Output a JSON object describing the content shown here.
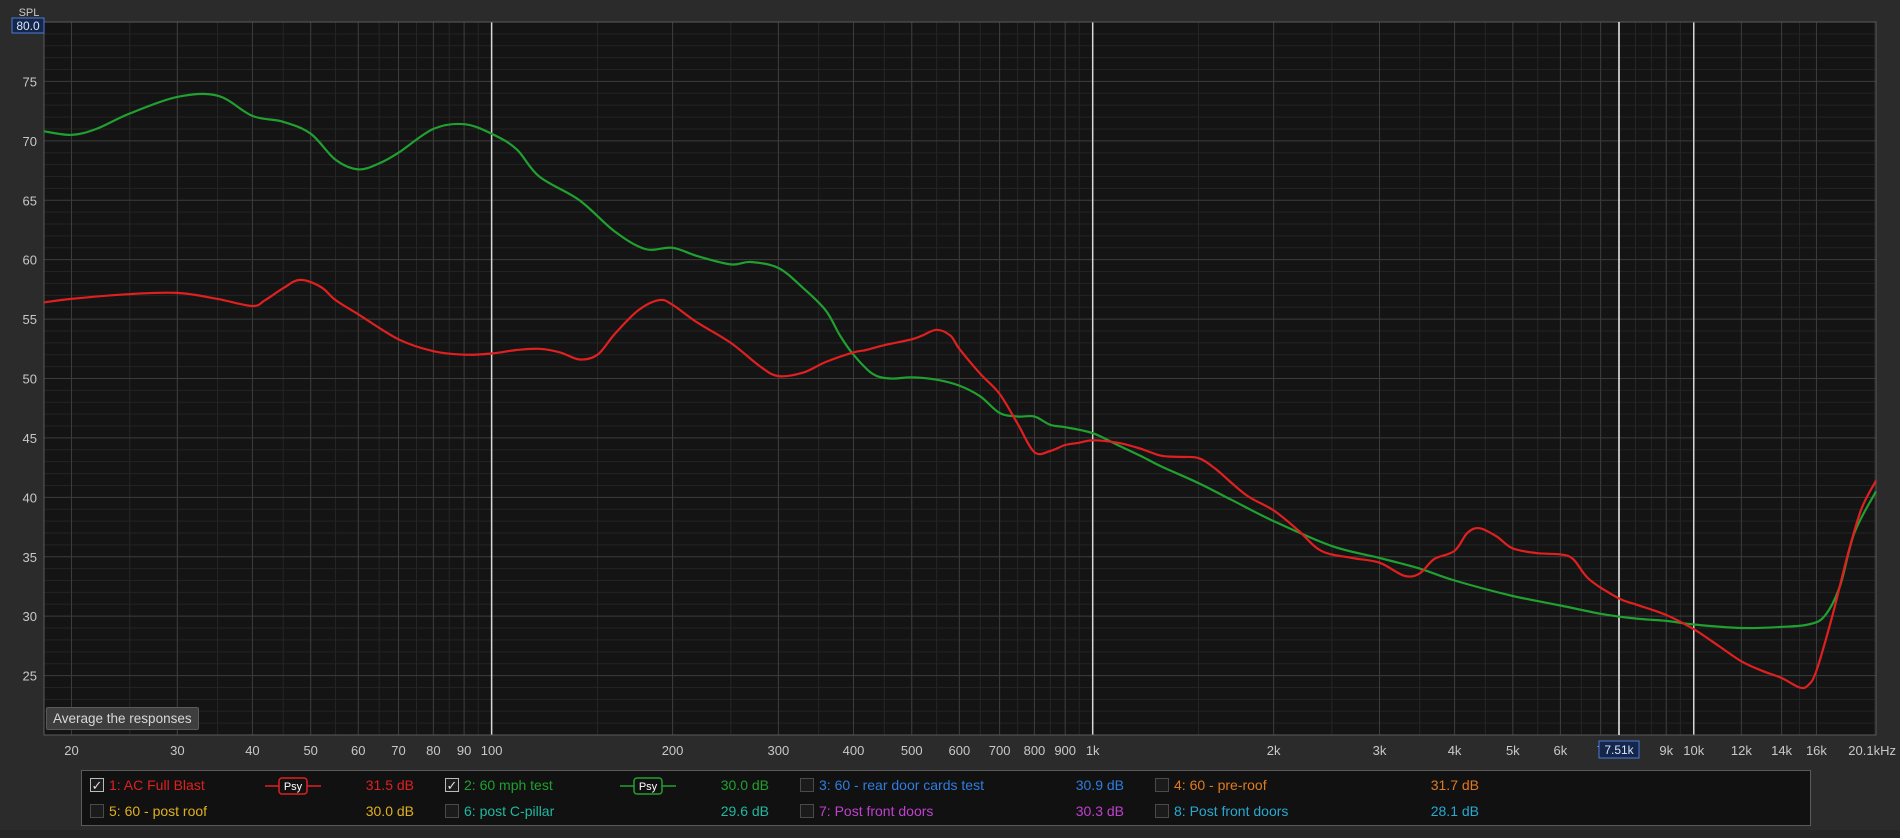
{
  "chart_data": {
    "type": "line",
    "x_scale": "log",
    "xlim": [
      18,
      20100
    ],
    "ylim": [
      20,
      80
    ],
    "ylabel": "SPL",
    "y_top_label": "80.0",
    "y_ticks": [
      25,
      30,
      35,
      40,
      45,
      50,
      55,
      60,
      65,
      70,
      75
    ],
    "x_ticks": [
      {
        "v": 20,
        "label": "20"
      },
      {
        "v": 30,
        "label": "30"
      },
      {
        "v": 40,
        "label": "40"
      },
      {
        "v": 50,
        "label": "50"
      },
      {
        "v": 60,
        "label": "60"
      },
      {
        "v": 70,
        "label": "70"
      },
      {
        "v": 80,
        "label": "80"
      },
      {
        "v": 90,
        "label": "90"
      },
      {
        "v": 100,
        "label": "100"
      },
      {
        "v": 200,
        "label": "200"
      },
      {
        "v": 300,
        "label": "300"
      },
      {
        "v": 400,
        "label": "400"
      },
      {
        "v": 500,
        "label": "500"
      },
      {
        "v": 600,
        "label": "600"
      },
      {
        "v": 700,
        "label": "700"
      },
      {
        "v": 800,
        "label": "800"
      },
      {
        "v": 900,
        "label": "900"
      },
      {
        "v": 1000,
        "label": "1k"
      },
      {
        "v": 2000,
        "label": "2k"
      },
      {
        "v": 3000,
        "label": "3k"
      },
      {
        "v": 4000,
        "label": "4k"
      },
      {
        "v": 5000,
        "label": "5k"
      },
      {
        "v": 6000,
        "label": "6k"
      },
      {
        "v": 7000,
        "label": "7"
      },
      {
        "v": 9000,
        "label": "9k"
      },
      {
        "v": 10000,
        "label": "10k"
      },
      {
        "v": 12000,
        "label": "12k"
      },
      {
        "v": 14000,
        "label": "14k"
      },
      {
        "v": 16000,
        "label": "16k"
      },
      {
        "v": 20100,
        "label": "20.1kHz"
      }
    ],
    "cursor": {
      "freq": 7510,
      "label": "7.51k"
    },
    "grid": true,
    "series": [
      {
        "name": "1: AC Full Blast",
        "color": "#e02020",
        "points": [
          [
            18,
            56.4
          ],
          [
            20,
            56.7
          ],
          [
            25,
            57.1
          ],
          [
            30,
            57.2
          ],
          [
            35,
            56.7
          ],
          [
            40,
            56.1
          ],
          [
            42,
            56.6
          ],
          [
            45,
            57.6
          ],
          [
            48,
            58.3
          ],
          [
            52,
            57.7
          ],
          [
            55,
            56.6
          ],
          [
            60,
            55.4
          ],
          [
            70,
            53.3
          ],
          [
            80,
            52.3
          ],
          [
            90,
            52.0
          ],
          [
            100,
            52.1
          ],
          [
            110,
            52.4
          ],
          [
            120,
            52.5
          ],
          [
            130,
            52.2
          ],
          [
            140,
            51.6
          ],
          [
            150,
            52.0
          ],
          [
            160,
            53.7
          ],
          [
            175,
            55.7
          ],
          [
            190,
            56.6
          ],
          [
            200,
            56.2
          ],
          [
            220,
            54.7
          ],
          [
            250,
            53.0
          ],
          [
            280,
            51.0
          ],
          [
            300,
            50.2
          ],
          [
            330,
            50.5
          ],
          [
            360,
            51.4
          ],
          [
            400,
            52.2
          ],
          [
            420,
            52.4
          ],
          [
            450,
            52.8
          ],
          [
            500,
            53.3
          ],
          [
            520,
            53.6
          ],
          [
            550,
            54.1
          ],
          [
            580,
            53.6
          ],
          [
            600,
            52.5
          ],
          [
            650,
            50.4
          ],
          [
            700,
            48.7
          ],
          [
            750,
            46.2
          ],
          [
            800,
            43.8
          ],
          [
            850,
            43.9
          ],
          [
            900,
            44.4
          ],
          [
            950,
            44.6
          ],
          [
            1000,
            44.8
          ],
          [
            1100,
            44.6
          ],
          [
            1200,
            44.1
          ],
          [
            1300,
            43.5
          ],
          [
            1400,
            43.4
          ],
          [
            1500,
            43.3
          ],
          [
            1600,
            42.4
          ],
          [
            1800,
            40.2
          ],
          [
            2000,
            38.9
          ],
          [
            2200,
            37.2
          ],
          [
            2400,
            35.5
          ],
          [
            2700,
            34.9
          ],
          [
            3000,
            34.5
          ],
          [
            3300,
            33.4
          ],
          [
            3500,
            33.6
          ],
          [
            3700,
            34.8
          ],
          [
            4000,
            35.5
          ],
          [
            4200,
            37.0
          ],
          [
            4400,
            37.4
          ],
          [
            4700,
            36.7
          ],
          [
            5000,
            35.7
          ],
          [
            5500,
            35.3
          ],
          [
            6000,
            35.2
          ],
          [
            6300,
            34.8
          ],
          [
            6700,
            33.1
          ],
          [
            7500,
            31.5
          ],
          [
            8000,
            31.0
          ],
          [
            9000,
            30.1
          ],
          [
            10000,
            28.9
          ],
          [
            11000,
            27.5
          ],
          [
            12000,
            26.2
          ],
          [
            13000,
            25.4
          ],
          [
            14000,
            24.8
          ],
          [
            15000,
            24.0
          ],
          [
            15500,
            24.2
          ],
          [
            16000,
            25.4
          ],
          [
            17000,
            30.0
          ],
          [
            18000,
            35.0
          ],
          [
            19000,
            39.0
          ],
          [
            20100,
            41.4
          ]
        ]
      },
      {
        "name": "2: 60 mph test",
        "color": "#20a030",
        "points": [
          [
            18,
            70.8
          ],
          [
            20,
            70.5
          ],
          [
            22,
            71.0
          ],
          [
            25,
            72.3
          ],
          [
            30,
            73.7
          ],
          [
            35,
            73.8
          ],
          [
            40,
            72.1
          ],
          [
            45,
            71.6
          ],
          [
            50,
            70.6
          ],
          [
            55,
            68.4
          ],
          [
            60,
            67.6
          ],
          [
            65,
            68.1
          ],
          [
            70,
            69.0
          ],
          [
            80,
            71.0
          ],
          [
            90,
            71.4
          ],
          [
            100,
            70.6
          ],
          [
            110,
            69.3
          ],
          [
            120,
            67.0
          ],
          [
            140,
            65.0
          ],
          [
            160,
            62.4
          ],
          [
            180,
            60.9
          ],
          [
            200,
            61.0
          ],
          [
            220,
            60.3
          ],
          [
            250,
            59.6
          ],
          [
            270,
            59.8
          ],
          [
            300,
            59.3
          ],
          [
            330,
            57.6
          ],
          [
            360,
            55.7
          ],
          [
            380,
            53.6
          ],
          [
            400,
            52.0
          ],
          [
            430,
            50.4
          ],
          [
            460,
            50.0
          ],
          [
            500,
            50.1
          ],
          [
            550,
            49.9
          ],
          [
            600,
            49.4
          ],
          [
            650,
            48.5
          ],
          [
            700,
            47.1
          ],
          [
            750,
            46.8
          ],
          [
            800,
            46.8
          ],
          [
            850,
            46.1
          ],
          [
            900,
            45.9
          ],
          [
            1000,
            45.4
          ],
          [
            1100,
            44.4
          ],
          [
            1200,
            43.5
          ],
          [
            1300,
            42.6
          ],
          [
            1500,
            41.2
          ],
          [
            1700,
            39.8
          ],
          [
            2000,
            38.0
          ],
          [
            2500,
            35.9
          ],
          [
            3000,
            34.9
          ],
          [
            3500,
            34.0
          ],
          [
            4000,
            33.0
          ],
          [
            5000,
            31.7
          ],
          [
            6000,
            30.9
          ],
          [
            7000,
            30.2
          ],
          [
            8000,
            29.8
          ],
          [
            9000,
            29.6
          ],
          [
            10000,
            29.3
          ],
          [
            12000,
            29.0
          ],
          [
            14000,
            29.1
          ],
          [
            15500,
            29.3
          ],
          [
            16500,
            30.0
          ],
          [
            17500,
            32.5
          ],
          [
            18500,
            37.0
          ],
          [
            20100,
            40.5
          ]
        ]
      }
    ]
  },
  "button": {
    "average": "Average the responses"
  },
  "psy_label": "Psy",
  "legend": {
    "rows": [
      [
        {
          "label": "1: AC Full Blast",
          "value": "31.5 dB",
          "color": "#e02020",
          "value_color": "#e02020",
          "checked": true,
          "psy": true
        },
        {
          "label": "2: 60 mph test",
          "value": "30.0 dB",
          "color": "#20a030",
          "value_color": "#20a030",
          "checked": true,
          "psy": true
        },
        {
          "label": "3: 60 - rear door cards test",
          "value": "30.9 dB",
          "color": "#2f7de0",
          "value_color": "#2f7de0",
          "checked": false,
          "psy": false
        },
        {
          "label": "4: 60 - pre-roof",
          "value": "31.7 dB",
          "color": "#e07a20",
          "value_color": "#e07a20",
          "checked": false,
          "psy": false
        }
      ],
      [
        {
          "label": "5: 60 - post roof",
          "value": "30.0 dB",
          "color": "#e0b020",
          "value_color": "#e0b020",
          "checked": false,
          "psy": false
        },
        {
          "label": "6: post C-pillar",
          "value": "29.6 dB",
          "color": "#20b8a0",
          "value_color": "#20b8a0",
          "checked": false,
          "psy": false
        },
        {
          "label": "7: Post front doors",
          "value": "30.3 dB",
          "color": "#c040d0",
          "value_color": "#c040d0",
          "checked": false,
          "psy": false
        },
        {
          "label": "8: Post front doors",
          "value": "28.1 dB",
          "color": "#2aa8d0",
          "value_color": "#2aa8d0",
          "checked": false,
          "psy": false
        }
      ]
    ]
  }
}
